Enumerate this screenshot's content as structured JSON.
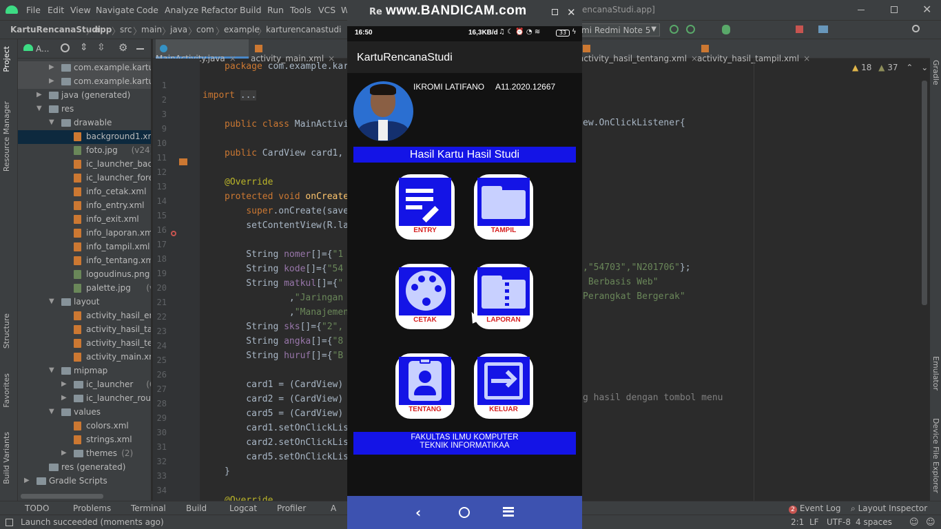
{
  "menu": [
    "File",
    "Edit",
    "View",
    "Navigate",
    "Code",
    "Analyze",
    "Refactor",
    "Build",
    "Run",
    "Tools",
    "VCS",
    "W"
  ],
  "window_title_tail": "encanaStudi.app]",
  "breadcrumb": [
    "KartuRencanaStudi",
    "app",
    "src",
    "main",
    "java",
    "com",
    "example",
    "karturencanastudi"
  ],
  "device": "mi Redmi Note 5",
  "project_selector": "A...",
  "editor_tabs": [
    {
      "label": "MainActivity.java",
      "active": true
    },
    {
      "label": "activity_main.xml",
      "active": false
    },
    {
      "label": "activity_hasil_tentang.xml",
      "active": false
    },
    {
      "label": "activity_hasil_tampil.xml",
      "active": false
    }
  ],
  "inspections": {
    "warnings": "18",
    "weak": "37"
  },
  "tree": [
    {
      "label": "com.example.karturer",
      "indent": 1,
      "type": "folder",
      "arrow": "right",
      "hl": true
    },
    {
      "label": "com.example.karturer",
      "indent": 1,
      "type": "folder",
      "arrow": "right",
      "hl": true
    },
    {
      "label": "java (generated)",
      "indent": 0,
      "type": "folder",
      "arrow": "right"
    },
    {
      "label": "res",
      "indent": 0,
      "type": "folder",
      "arrow": "down"
    },
    {
      "label": "drawable",
      "indent": 1,
      "type": "folder",
      "arrow": "down"
    },
    {
      "label": "background1.xml",
      "indent": 2,
      "type": "file",
      "sel": true
    },
    {
      "label": "foto.jpg",
      "extra": "(v24)",
      "indent": 2,
      "type": "img"
    },
    {
      "label": "ic_launcher_backg",
      "indent": 2,
      "type": "file"
    },
    {
      "label": "ic_launcher_foregr",
      "indent": 2,
      "type": "file"
    },
    {
      "label": "info_cetak.xml",
      "indent": 2,
      "type": "file"
    },
    {
      "label": "info_entry.xml",
      "indent": 2,
      "type": "file"
    },
    {
      "label": "info_exit.xml",
      "indent": 2,
      "type": "file"
    },
    {
      "label": "info_laporan.xml",
      "indent": 2,
      "type": "file"
    },
    {
      "label": "info_tampil.xml",
      "indent": 2,
      "type": "file"
    },
    {
      "label": "info_tentang.xml",
      "indent": 2,
      "type": "file"
    },
    {
      "label": "logoudinus.png",
      "extra": "(v",
      "indent": 2,
      "type": "img"
    },
    {
      "label": "palette.jpg",
      "extra": "(v24)",
      "indent": 2,
      "type": "img"
    },
    {
      "label": "layout",
      "indent": 1,
      "type": "folder",
      "arrow": "down"
    },
    {
      "label": "activity_hasil_entry",
      "indent": 2,
      "type": "file"
    },
    {
      "label": "activity_hasil_tamp",
      "indent": 2,
      "type": "file"
    },
    {
      "label": "activity_hasil_tenta",
      "indent": 2,
      "type": "file"
    },
    {
      "label": "activity_main.xml",
      "indent": 2,
      "type": "file"
    },
    {
      "label": "mipmap",
      "indent": 1,
      "type": "folder",
      "arrow": "down"
    },
    {
      "label": "ic_launcher",
      "extra": "(6)",
      "indent": 2,
      "type": "folder",
      "arrow": "right"
    },
    {
      "label": "ic_launcher_round",
      "indent": 2,
      "type": "folder",
      "arrow": "right"
    },
    {
      "label": "values",
      "indent": 1,
      "type": "folder",
      "arrow": "down"
    },
    {
      "label": "colors.xml",
      "indent": 2,
      "type": "file"
    },
    {
      "label": "strings.xml",
      "indent": 2,
      "type": "file"
    },
    {
      "label": "themes",
      "extra": "(2)",
      "indent": 2,
      "type": "folder",
      "arrow": "right"
    },
    {
      "label": "res (generated)",
      "indent": 0,
      "type": "folder"
    },
    {
      "label": "Gradle Scripts",
      "indent": -1,
      "type": "folder",
      "arrow": "right"
    }
  ],
  "code_lines": [
    {
      "n": "1",
      "html": "<span class='kw'>package</span> com.example.kar"
    },
    {
      "n": "2",
      "html": ""
    },
    {
      "n": "3",
      "html": "<span class='kw'>import</span> <span style='background:#3b3b3b'>...</span>",
      "col": -32
    },
    {
      "n": "9",
      "html": ""
    },
    {
      "n": "10",
      "html": "<span class='kw'>public class</span> MainActivi"
    },
    {
      "n": "11",
      "html": ""
    },
    {
      "n": "12",
      "html": "<span class='kw'>public</span> CardView card1,"
    },
    {
      "n": "13",
      "html": ""
    },
    {
      "n": "14",
      "html": "<span class='ann'>@Override</span>"
    },
    {
      "n": "15",
      "html": "<span class='kw'>protected void</span> <span class='mth'>onCreate</span>"
    },
    {
      "n": "16",
      "html": "    <span class='kw'>super</span>.onCreate(save"
    },
    {
      "n": "17",
      "html": "    setContentView(R.la"
    },
    {
      "n": "18",
      "html": ""
    },
    {
      "n": "19",
      "html": "    String <span class='fld'>nomer</span>[]={<span class='str'>\"1</span>"
    },
    {
      "n": "20",
      "html": "    String <span class='fld'>kode</span>[]={<span class='str'>\"54</span>"
    },
    {
      "n": "21",
      "html": "    String <span class='fld'>matkul</span>[]={<span class='str'>\"</span>"
    },
    {
      "n": "22",
      "html": "            ,<span class='str'>\"Jaringan</span>"
    },
    {
      "n": "23",
      "html": "            ,<span class='str'>\"Manajemen</span>"
    },
    {
      "n": "24",
      "html": "    String <span class='fld'>sks</span>[]={<span class='str'>\"2\",</span>"
    },
    {
      "n": "25",
      "html": "    String <span class='fld'>angka</span>[]={<span class='str'>\"8</span>"
    },
    {
      "n": "26",
      "html": "    String <span class='fld'>huruf</span>[]={<span class='str'>\"B</span>"
    },
    {
      "n": "27",
      "html": ""
    },
    {
      "n": "28",
      "html": "    card1 = (CardView)"
    },
    {
      "n": "29",
      "html": "    card2 = (CardView)"
    },
    {
      "n": "30",
      "html": "    card5 = (CardView)"
    },
    {
      "n": "31",
      "html": "    card1.setOnClickLis"
    },
    {
      "n": "32",
      "html": "    card2.setOnClickLis"
    },
    {
      "n": "33",
      "html": "    card5.setOnClickLis"
    },
    {
      "n": "34",
      "html": "}"
    },
    {
      "n": "35",
      "html": ""
    },
    {
      "n": "36",
      "html": "<span class='ann'>@Override</span>"
    }
  ],
  "code_right": [
    {
      "row": 4,
      "html": "ew.OnClickListener{"
    },
    {
      "row": 14,
      "html": "<span class='str'>,\"54703\",\"N201706\"</span>};"
    },
    {
      "row": 15,
      "html": "<span class='str'> Berbasis Web\"</span>"
    },
    {
      "row": 16,
      "html": "<span class='str'>Perangkat Bergerak\"</span>"
    },
    {
      "row": 23,
      "html": "<span style='color:#808080'>g hasil dengan tombol menu</span>"
    }
  ],
  "bottom_tabs": [
    "TODO",
    "Problems",
    "Terminal",
    "Build",
    "Logcat",
    "Profiler",
    "A"
  ],
  "bottom_right": {
    "event_log": "Event Log",
    "event_count": "2",
    "layout_inspector": "Layout Inspector"
  },
  "status": {
    "message": "Launch succeeded (moments ago)",
    "pos": "2:1",
    "lf": "LF",
    "enc": "UTF-8",
    "indent": "4 spaces"
  },
  "left_tabs": [
    "Project",
    "Resource Manager",
    "Structure",
    "Favorites",
    "Build Variants"
  ],
  "right_tabs": [
    "Gradle",
    "Emulator",
    "Device File Explorer"
  ],
  "emulator": {
    "title": "Re",
    "watermark": "www.BANDICAM.com",
    "time": "16:50",
    "net": "16,3KB/d",
    "battery": "33",
    "app_title": "KartuRencanaStudi",
    "student_name": "IKROMI LATIFANO",
    "student_id": "A11.2020.12667",
    "header_banner": "Hasil Kartu Hasil Studi",
    "cards": [
      "ENTRY",
      "TAMPIL",
      "CETAK",
      "LAPORAN",
      "TENTANG",
      "KELUAR"
    ],
    "footer_line1": "FAKULTAS ILMU KOMPUTER",
    "footer_line2": "TEKNIK INFORMATIKAA",
    "accent": "#1414e6",
    "navbar_color": "#3d52b0"
  }
}
